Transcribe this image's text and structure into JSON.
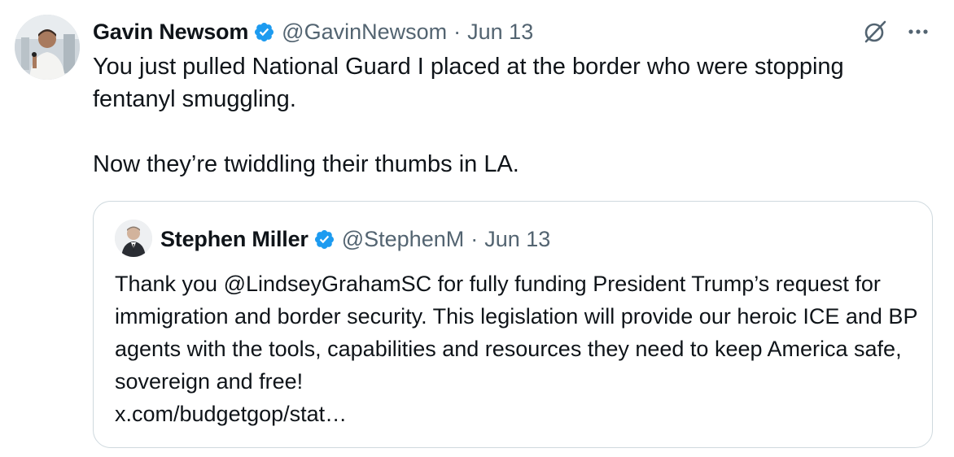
{
  "tweet": {
    "author": {
      "name": "Gavin Newsom",
      "handle": "@GavinNewsom",
      "verified": true,
      "avatar_icon": "person-avatar-icon"
    },
    "separator": "·",
    "date": "Jun 13",
    "body": [
      "You just pulled National Guard I placed at the border who were stopping fentanyl smuggling.",
      "Now they’re twiddling their thumbs in LA."
    ],
    "actions": {
      "grok_icon": "grok-icon",
      "more_icon": "more-options-icon"
    }
  },
  "quoted_tweet": {
    "author": {
      "name": "Stephen Miller",
      "handle": "@StephenM",
      "verified": true,
      "avatar_icon": "person-avatar-icon"
    },
    "separator": "·",
    "date": "Jun 13",
    "body": "Thank you @LindseyGrahamSC for fully funding President Trump’s request for immigration and border security. This legislation will provide our heroic ICE and BP agents with the tools, capabilities and resources they need to keep America safe, sovereign and free!",
    "link": "x.com/budgetgop/stat…"
  },
  "colors": {
    "text": "#0f1419",
    "secondary": "#536471",
    "verified_badge": "#1d9bf0",
    "border": "#cfd9de"
  }
}
